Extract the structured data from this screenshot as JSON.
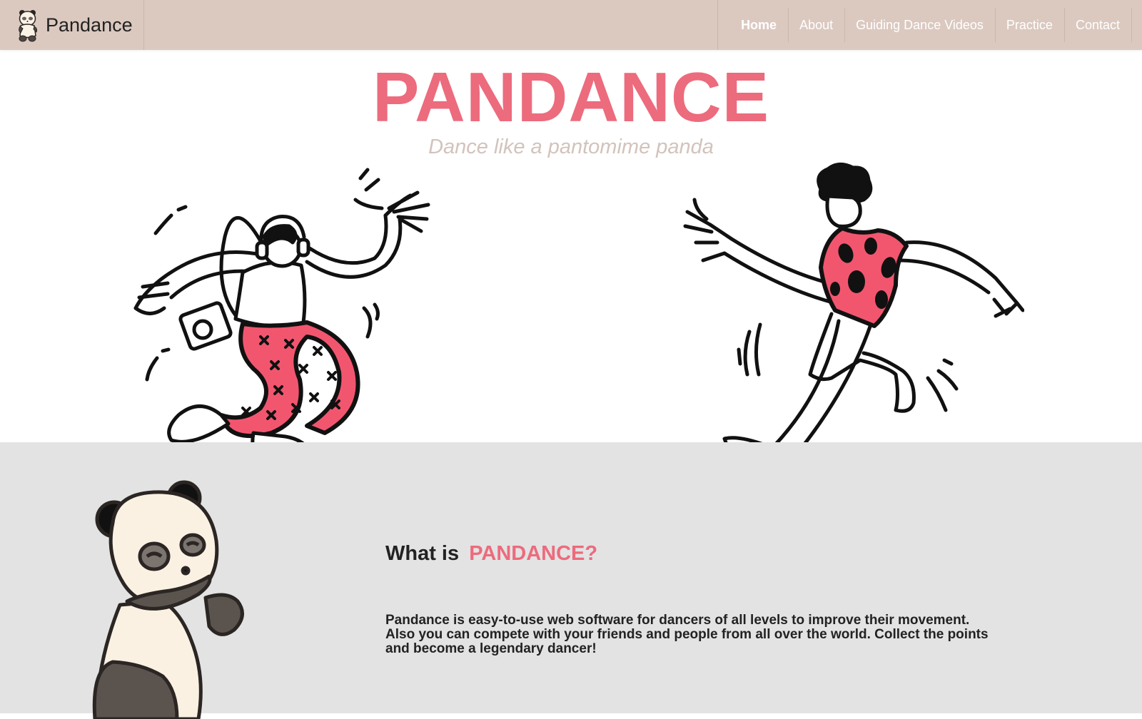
{
  "navbar": {
    "brand_name": "Pandance",
    "logo_icon": "panda-logo-icon",
    "items": [
      {
        "label": "Home",
        "active": true
      },
      {
        "label": "About"
      },
      {
        "label": "Guiding Dance Videos"
      },
      {
        "label": "Practice"
      },
      {
        "label": "Contact"
      }
    ]
  },
  "hero": {
    "title": "PANDANCE",
    "subtitle": "Dance like a pantomime panda",
    "illustrations": [
      "dancer-headphones-illustration",
      "dancer-spotted-shirt-illustration"
    ]
  },
  "about": {
    "heading_prefix": "What is",
    "heading_accent": "PANDANCE?",
    "body": "Pandance is easy-to-use web software for dancers of all levels to improve their movement. Also you can compete with your friends and people from all over the world. Collect the points and become a legendary dancer!",
    "illustration": "panda-mascot-illustration"
  },
  "colors": {
    "navbar_bg": "#dbc9c0",
    "accent": "#ec6b7d",
    "subtitle": "#d2c3bc",
    "about_bg": "#e3e3e3",
    "text": "#222222"
  }
}
